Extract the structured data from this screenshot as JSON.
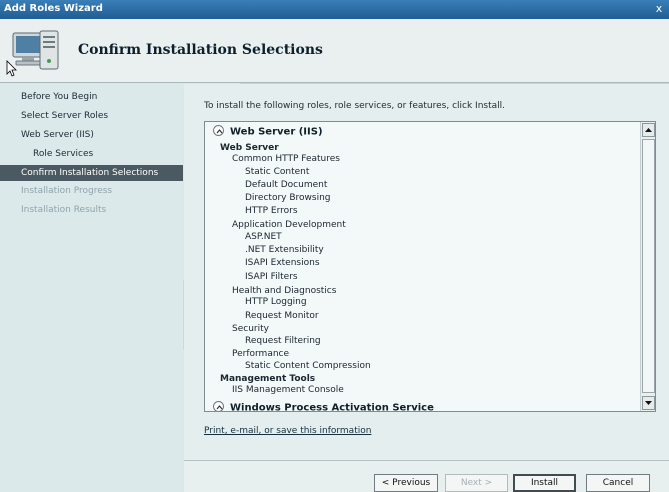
{
  "window": {
    "title": "Add Roles Wizard",
    "close_glyph": "x"
  },
  "header": {
    "heading": "Confirm Installation Selections",
    "icon": "server-wizard-icon"
  },
  "sidebar": {
    "items": [
      {
        "label": "Before You Begin",
        "state": "normal"
      },
      {
        "label": "Select Server Roles",
        "state": "normal"
      },
      {
        "label": "Web Server (IIS)",
        "state": "normal"
      },
      {
        "label": "Role Services",
        "state": "normal"
      },
      {
        "label": "Confirm Installation Selections",
        "state": "active"
      },
      {
        "label": "Installation Progress",
        "state": "disabled"
      },
      {
        "label": "Installation Results",
        "state": "disabled"
      }
    ]
  },
  "main": {
    "intro": "To install the following roles, role services, or features, click Install.",
    "section_title": "Web Server (IIS)",
    "tree": [
      {
        "text": "Web Server",
        "level": 0,
        "bold": true
      },
      {
        "text": "Common HTTP Features",
        "level": 1
      },
      {
        "text": "Static Content",
        "level": 2
      },
      {
        "text": "Default Document",
        "level": 2
      },
      {
        "text": "Directory Browsing",
        "level": 2
      },
      {
        "text": "HTTP Errors",
        "level": 2
      },
      {
        "text": "Application Development",
        "level": 1
      },
      {
        "text": "ASP.NET",
        "level": 2
      },
      {
        "text": ".NET Extensibility",
        "level": 2
      },
      {
        "text": "ISAPI Extensions",
        "level": 2
      },
      {
        "text": "ISAPI Filters",
        "level": 2
      },
      {
        "text": "Health and Diagnostics",
        "level": 1
      },
      {
        "text": "HTTP Logging",
        "level": 2
      },
      {
        "text": "Request Monitor",
        "level": 2
      },
      {
        "text": "Security",
        "level": 1
      },
      {
        "text": "Request Filtering",
        "level": 2
      },
      {
        "text": "Performance",
        "level": 1
      },
      {
        "text": "Static Content Compression",
        "level": 2
      },
      {
        "text": "Management Tools",
        "level": 0,
        "bold": true
      },
      {
        "text": "IIS Management Console",
        "level": 1
      }
    ],
    "next_section_title": "Windows Process Activation Service",
    "print_link": "Print, e-mail, or save this information"
  },
  "footer": {
    "previous": "< Previous",
    "next": "Next >",
    "install": "Install",
    "cancel": "Cancel"
  }
}
